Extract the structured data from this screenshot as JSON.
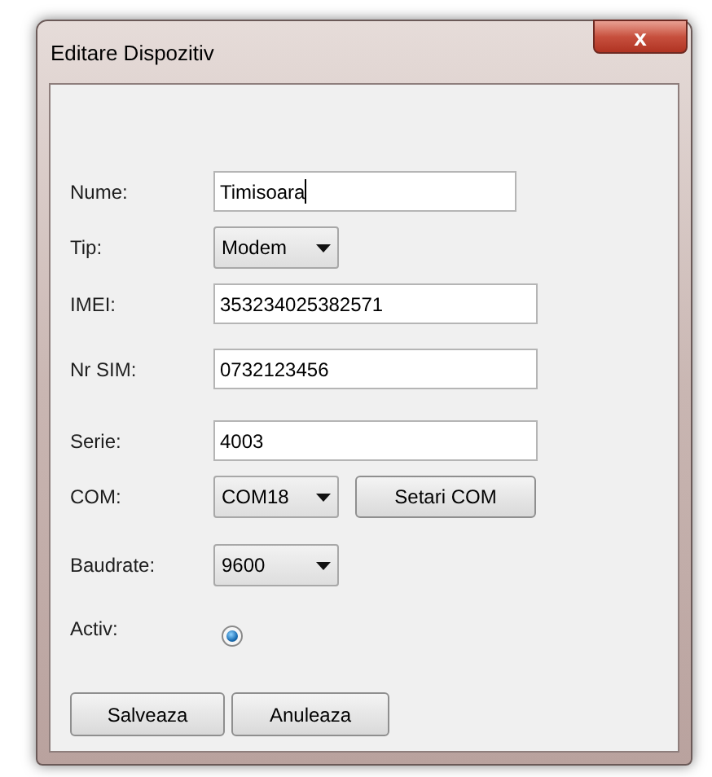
{
  "window": {
    "title": "Editare Dispozitiv",
    "close": "x"
  },
  "fields": [
    {
      "kind": "text",
      "label": "Nume:",
      "value": "Timisoara",
      "focused": true
    },
    {
      "kind": "dropdown",
      "label": "Tip:",
      "value": "Modem"
    },
    {
      "kind": "text",
      "label": "IMEI:",
      "value": "353234025382571",
      "focused": false
    },
    {
      "kind": "text",
      "label": "Nr SIM:",
      "value": "0732123456",
      "focused": false
    },
    {
      "kind": "text",
      "label": "Serie:",
      "value": "4003",
      "focused": false
    },
    {
      "kind": "dropdown",
      "label": "COM:",
      "value": "COM18",
      "button": "Setari COM"
    },
    {
      "kind": "dropdown",
      "label": "Baudrate:",
      "value": "9600"
    },
    {
      "kind": "radio",
      "label": "Activ:",
      "selected": true
    }
  ],
  "buttons": [
    "Salveaza",
    "Anuleaza"
  ]
}
